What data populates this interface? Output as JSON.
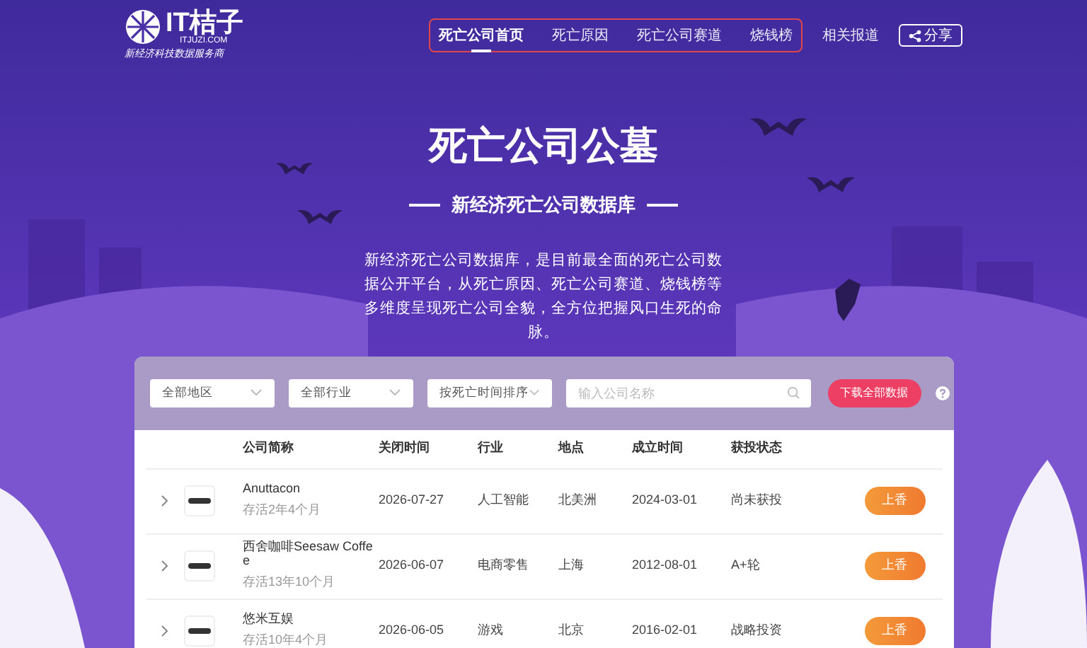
{
  "logo": {
    "name": "IT桔子",
    "domain": "ITJUZI.COM",
    "slogan": "新经济科技数据服务商"
  },
  "nav": {
    "framed_items": [
      {
        "label": "死亡公司首页",
        "selected": true
      },
      {
        "label": "死亡原因",
        "selected": false
      },
      {
        "label": "死亡公司赛道",
        "selected": false
      },
      {
        "label": "烧钱榜",
        "selected": false
      }
    ],
    "items": [
      {
        "label": "相关报道",
        "selected": false
      }
    ],
    "share": "分享"
  },
  "hero": {
    "title": "死亡公司公墓",
    "subtitle": "新经济死亡公司数据库",
    "description": "新经济死亡公司数据库，是目前最全面的死亡公司数据公开平台，从死亡原因、死亡公司赛道、烧钱榜等多维度呈现死亡公司全貌，全方位把握风口生死的命脉。"
  },
  "filters": {
    "selects": [
      "全部地区",
      "全部行业",
      "按死亡时间排序"
    ],
    "search": {
      "placeholder": "输入公司名称"
    },
    "download": "下载全部数据"
  },
  "table": {
    "columns": [
      "公司简称",
      "关闭时间",
      "行业",
      "地点",
      "成立时间",
      "获投状态"
    ],
    "rows": [
      {
        "name": "Anuttacon",
        "lifespan": "存活2年4个月",
        "closed": "2026-07-27",
        "industry": "人工智能",
        "location": "北美洲",
        "founded": "2024-03-01",
        "funding": "尚未获投",
        "action": "上香"
      },
      {
        "name": "西舍咖啡Seesaw Coffee",
        "lifespan": "存活13年10个月",
        "closed": "2026-06-07",
        "industry": "电商零售",
        "location": "上海",
        "founded": "2012-08-01",
        "funding": "A+轮",
        "action": "上香"
      },
      {
        "name": "悠米互娱",
        "lifespan": "存活10年4个月",
        "closed": "2026-06-05",
        "industry": "游戏",
        "location": "北京",
        "founded": "2016-02-01",
        "funding": "战略投资",
        "action": "上香"
      }
    ]
  }
}
